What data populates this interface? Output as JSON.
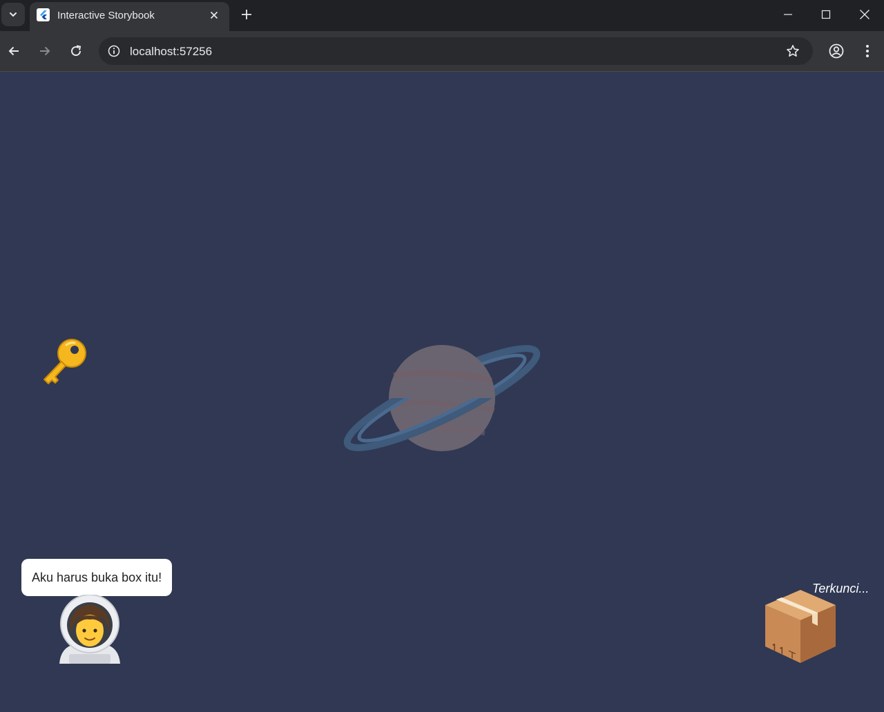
{
  "browser": {
    "tab_title": "Interactive Storybook",
    "url": "localhost:57256"
  },
  "scene": {
    "speech_bubble": "Aku harus buka box itu!",
    "box_status": "Terkunci...",
    "items": [
      "key-icon",
      "planet-icon",
      "astronaut-icon",
      "package-icon"
    ]
  },
  "colors": {
    "scene_background": "#303853",
    "chrome_dark": "#202124",
    "chrome_toolbar": "#35363a"
  }
}
